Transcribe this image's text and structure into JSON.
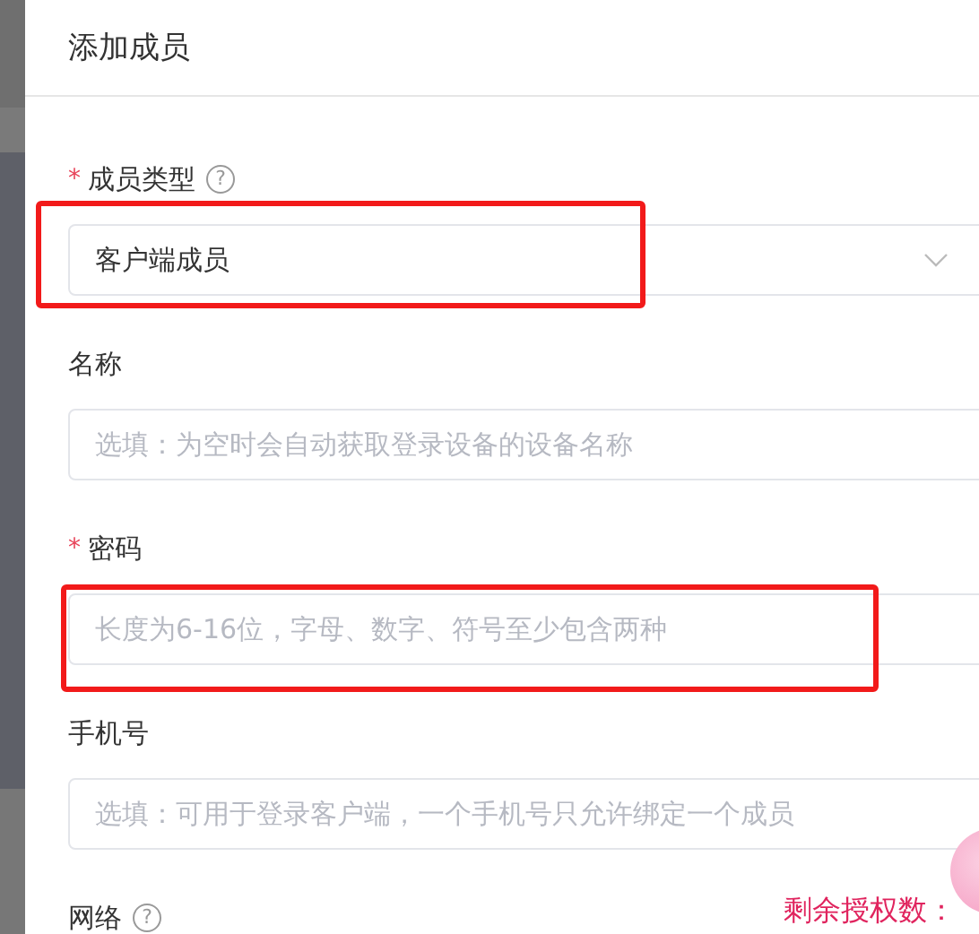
{
  "drawer": {
    "title": "添加成员"
  },
  "fields": [
    {
      "label": "成员类型",
      "required_mark": "*",
      "help_mark": "?",
      "kind": "select",
      "value": "客户端成员"
    },
    {
      "label": "名称",
      "kind": "input",
      "placeholder": "选填：为空时会自动获取登录设备的设备名称"
    },
    {
      "label": "密码",
      "required_mark": "*",
      "kind": "input",
      "placeholder": "长度为6-16位，字母、数字、符号至少包含两种"
    },
    {
      "label": "手机号",
      "kind": "input",
      "placeholder": "选填：可用于登录客户端，一个手机号只允许绑定一个成员"
    },
    {
      "label": "网络",
      "help_mark": "?",
      "kind": "label_only"
    }
  ],
  "license_note": "剩余授权数："
}
